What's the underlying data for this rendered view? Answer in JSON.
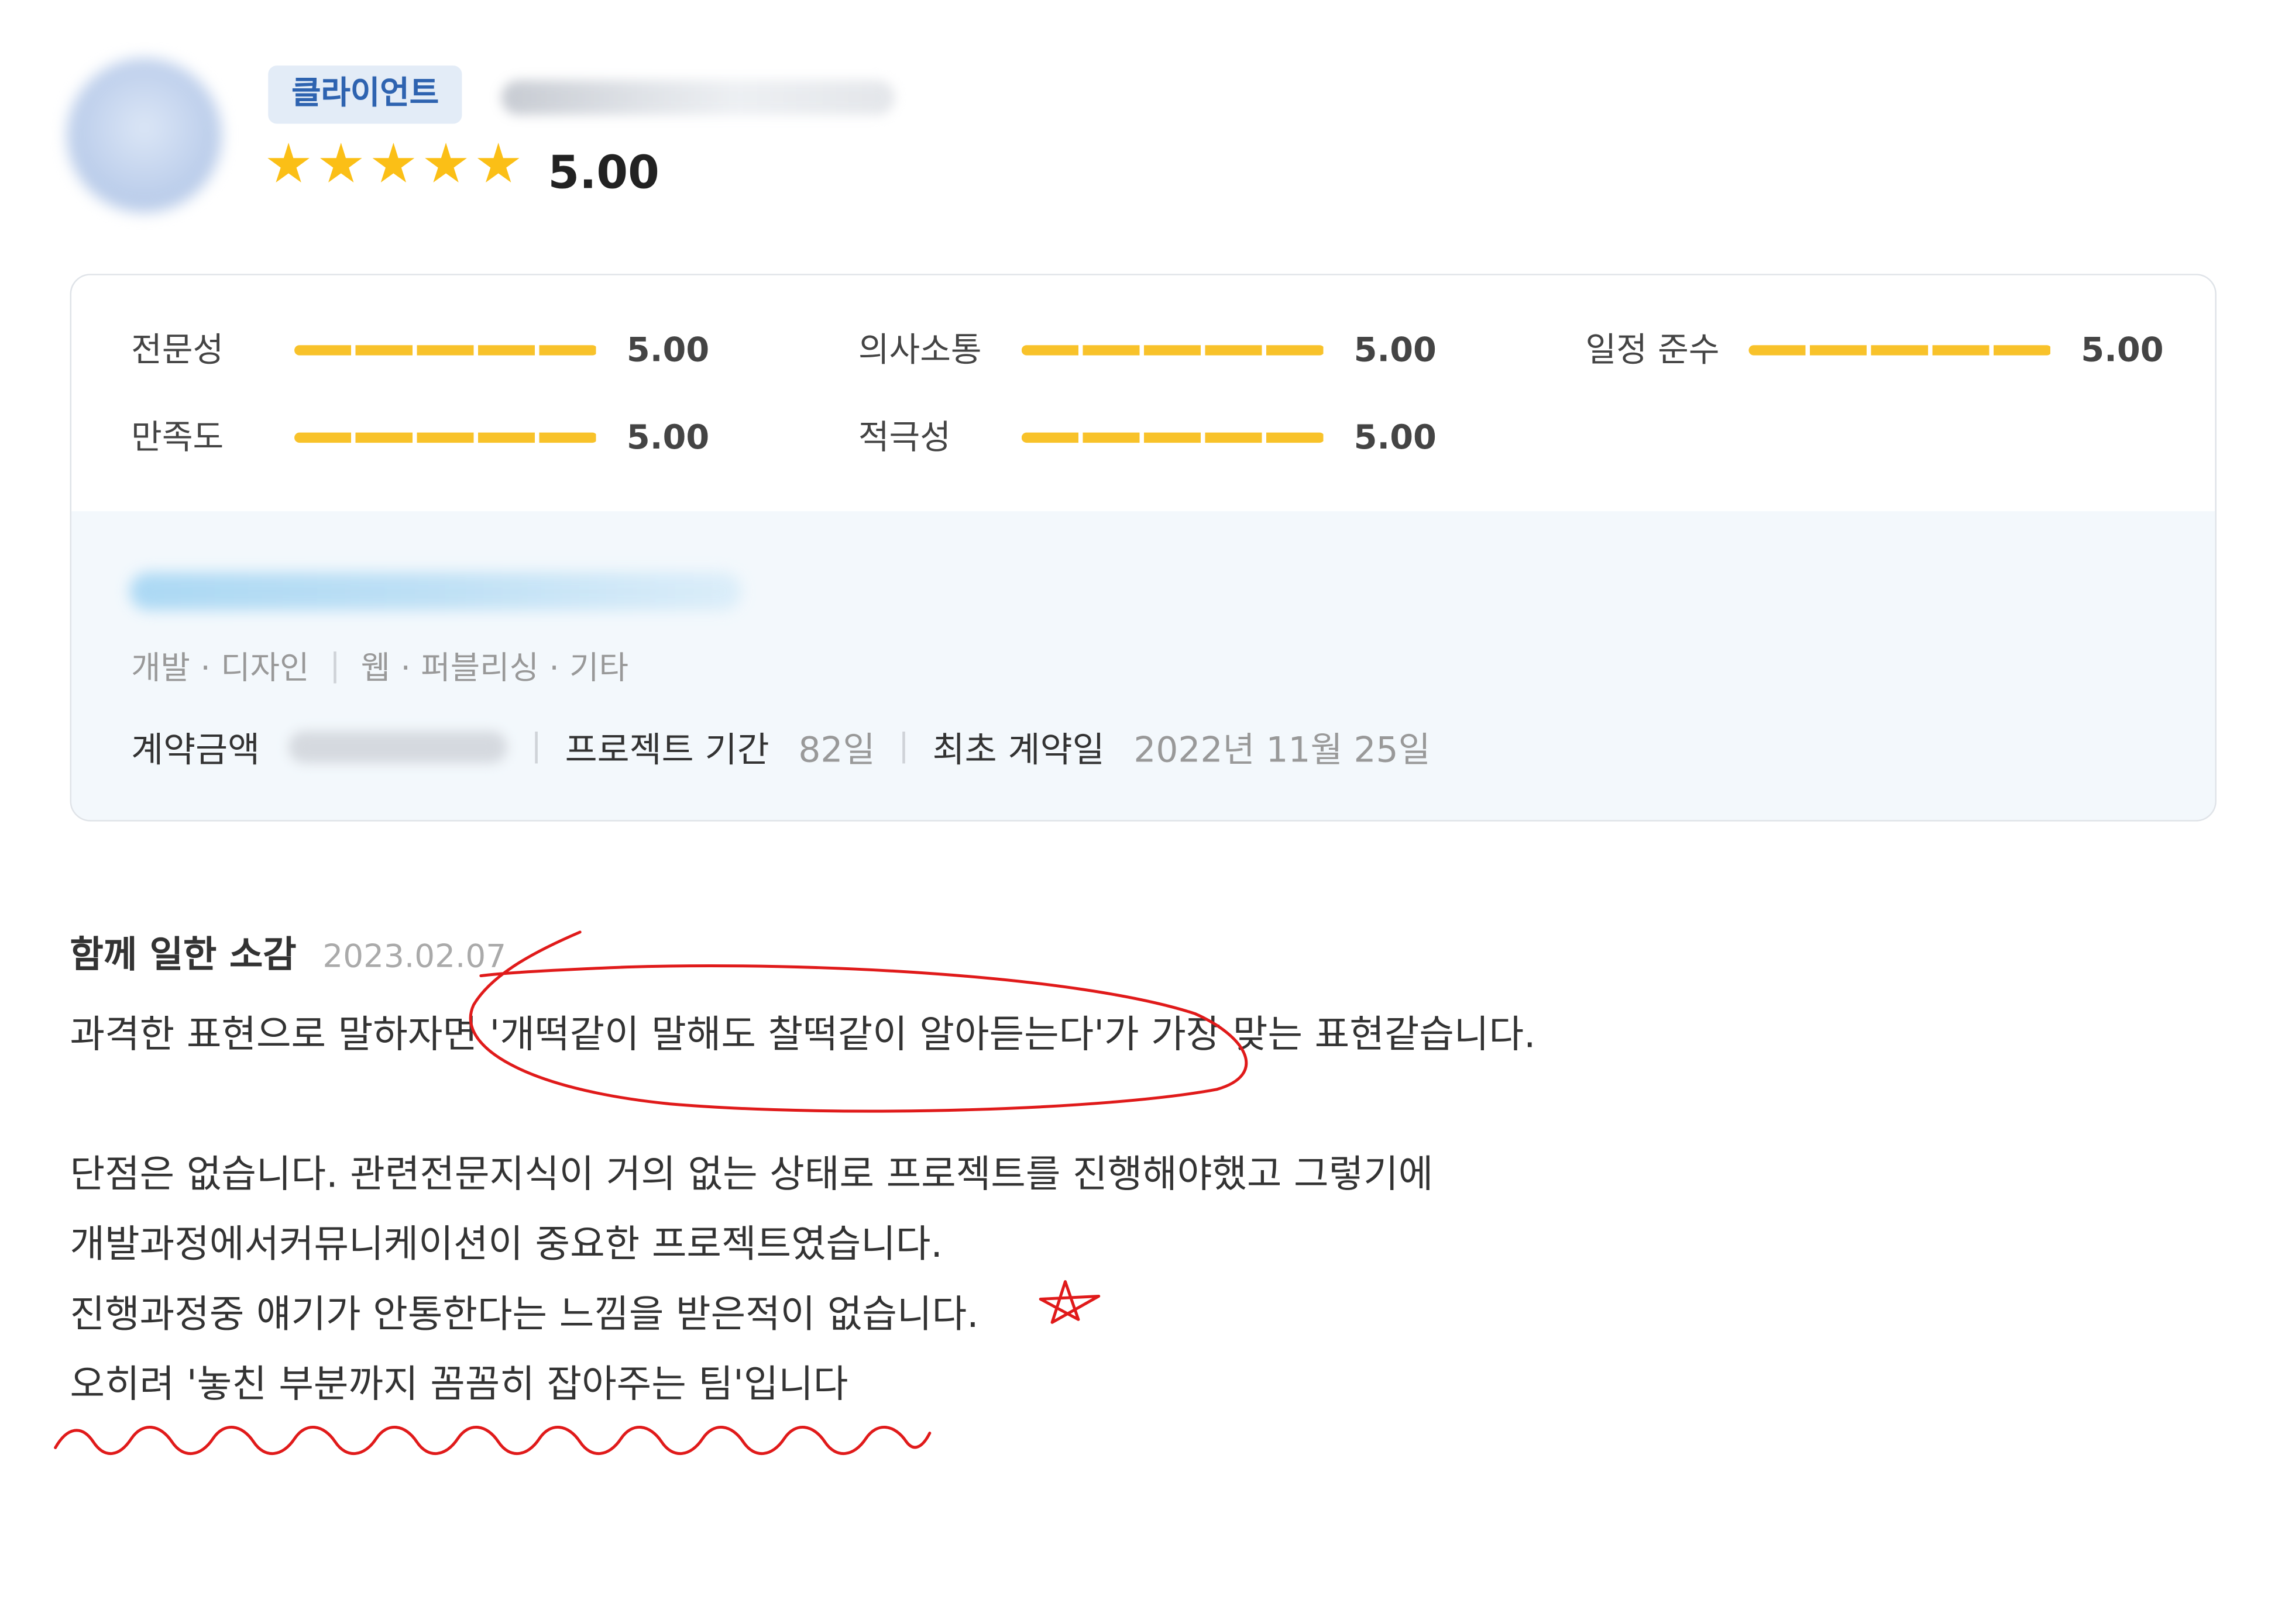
{
  "reviewer": {
    "role_badge": "클라이언트",
    "rating_value": 5.0,
    "rating_text": "5.00",
    "star_count": 5
  },
  "metrics": [
    {
      "label": "전문성",
      "value": "5.00",
      "fraction": 1.0
    },
    {
      "label": "의사소통",
      "value": "5.00",
      "fraction": 1.0
    },
    {
      "label": "일정 준수",
      "value": "5.00",
      "fraction": 1.0
    },
    {
      "label": "만족도",
      "value": "5.00",
      "fraction": 1.0
    },
    {
      "label": "적극성",
      "value": "5.00",
      "fraction": 1.0
    }
  ],
  "project": {
    "categories": [
      "개발 · 디자인",
      "웹 · 퍼블리싱 · 기타"
    ],
    "contract_amount_label": "계약금액",
    "duration_label": "프로젝트 기간",
    "duration_value": "82일",
    "first_contract_label": "최초 계약일",
    "first_contract_value": "2022년 11월 25일"
  },
  "review": {
    "title": "함께 일한 소감",
    "date": "2023.02.07",
    "lines": [
      "과격한 표현으로 말하자면 '개떡같이 말해도 찰떡같이 알아듣는다'가 가장 맞는 표현같습니다.",
      "단점은 없습니다. 관련전문지식이 거의 없는 상태로 프로젝트를 진행해야했고 그렇기에",
      "개발과정에서커뮤니케이션이 중요한 프로젝트였습니다.",
      "진행과정중 얘기가 안통한다는 느낌을 받은적이 없습니다.",
      "오히려 '놓친 부분까지 꼼꼼히 잡아주는 팀'입니다"
    ]
  },
  "colors": {
    "star": "#fbbf16",
    "bar": "#f8c22a",
    "badge_bg": "#e3ecf7",
    "badge_text": "#2e63b0",
    "annotation": "#e01a1a",
    "project_bg": "#f3f8fc"
  }
}
